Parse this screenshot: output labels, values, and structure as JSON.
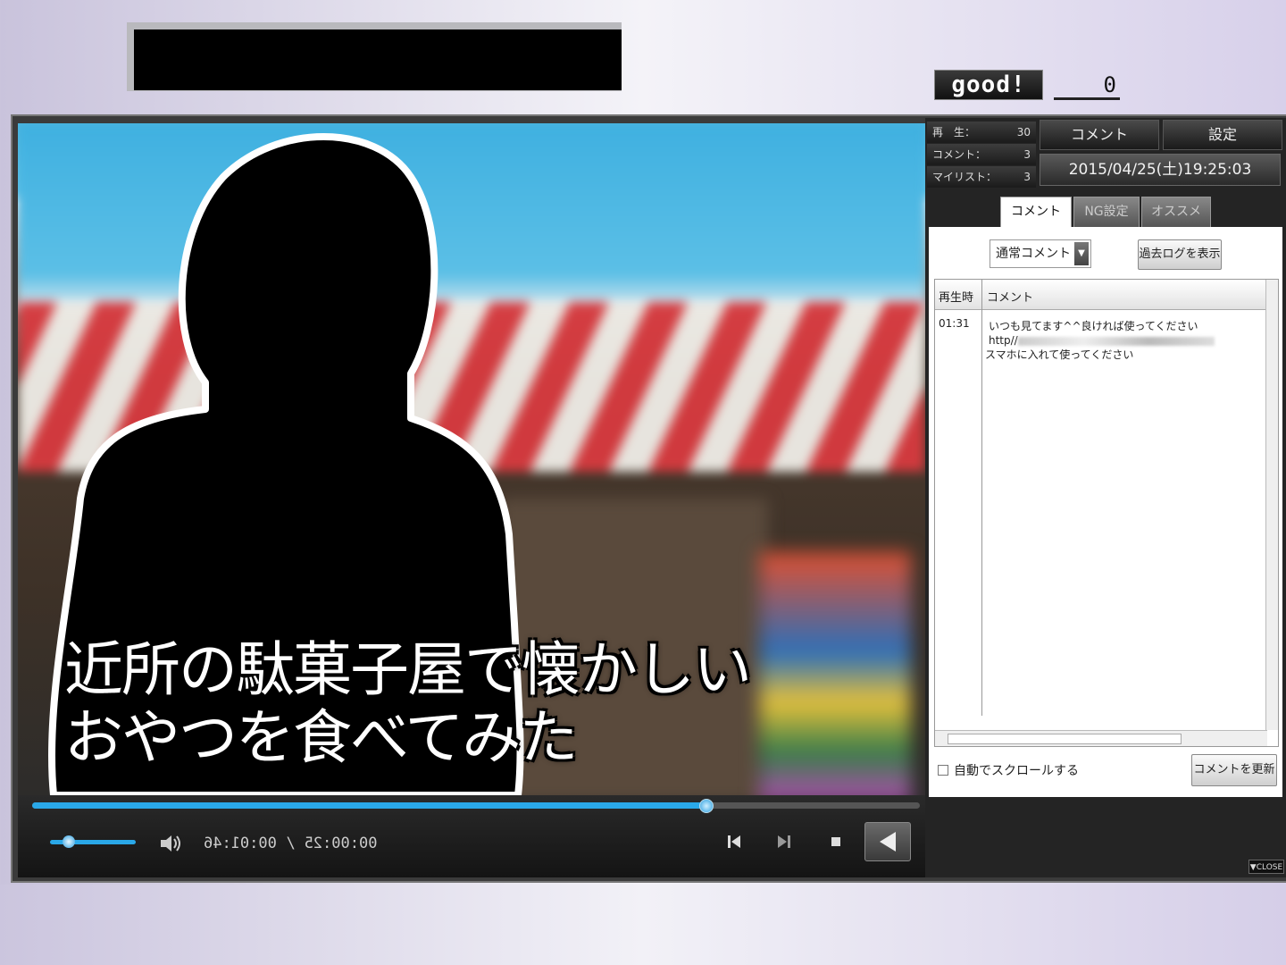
{
  "header": {
    "good_label": "good!",
    "good_count": "0"
  },
  "video": {
    "caption_line1": "近所の駄菓子屋で懐かしい",
    "caption_line2": "おやつを食べてみた",
    "progress_fraction": 0.76,
    "volume_fraction": 0.2,
    "time_display": "00:00:25 / 00:01:46"
  },
  "stats": {
    "plays_label": "再　生：",
    "plays_value": "30",
    "comments_label": "コメント：",
    "comments_value": "3",
    "mylist_label": "マイリスト：",
    "mylist_value": "3"
  },
  "top_buttons": {
    "comment": "コメント",
    "settings": "設定"
  },
  "datetime": "2015/04/25(土)19:25:03",
  "tabs": [
    {
      "label": "コメント",
      "active": true
    },
    {
      "label": "NG設定",
      "active": false
    },
    {
      "label": "オススメ",
      "active": false
    }
  ],
  "comment_panel": {
    "mode_select": "通常コメント",
    "past_log_button": "過去ログを表示",
    "columns": [
      "再生時",
      "コメント"
    ],
    "rows": [
      {
        "time": "01:31",
        "line1": "いつも見てます^^良ければ使ってください",
        "line2": "http//",
        "line3": "スマホに入れて使ってください"
      }
    ],
    "autoscroll_label": "自動でスクロールする",
    "refresh_button": "コメントを更新"
  },
  "close_label": "▼CLOSE",
  "colors": {
    "accent": "#2aa8e8",
    "panel_dark": "#242424"
  }
}
